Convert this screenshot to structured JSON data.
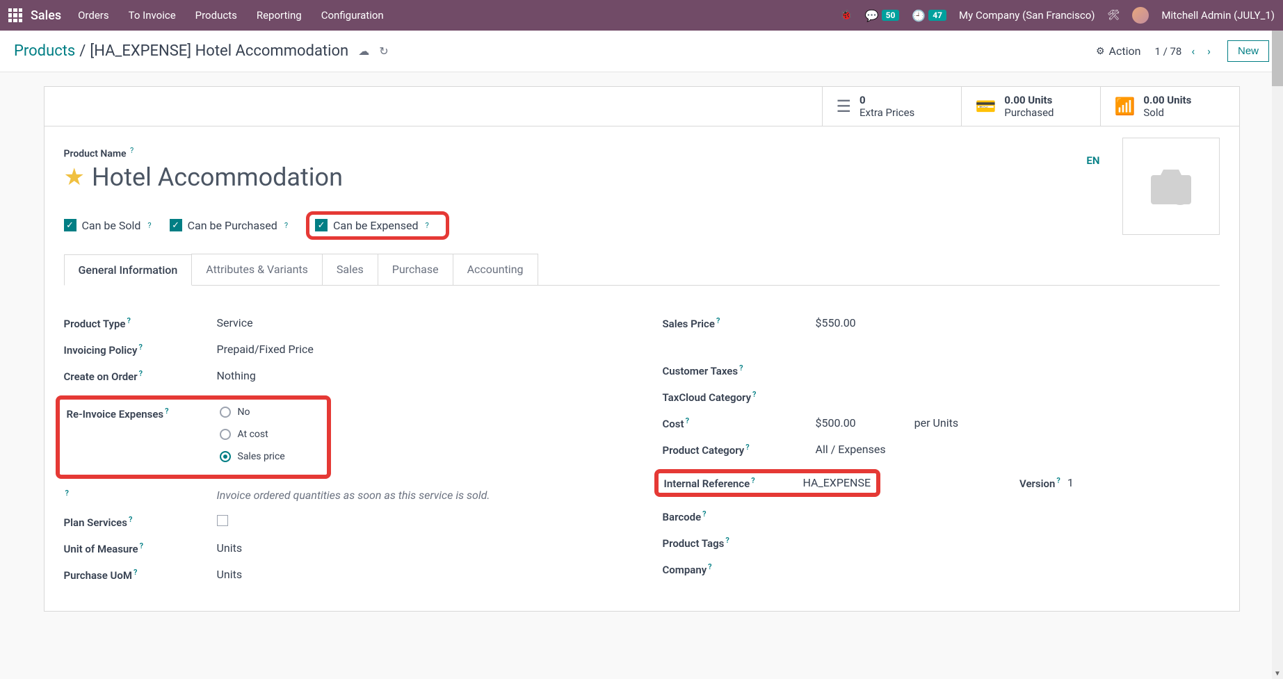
{
  "nav": {
    "app": "Sales",
    "links": [
      "Orders",
      "To Invoice",
      "Products",
      "Reporting",
      "Configuration"
    ],
    "messages_count": "50",
    "activities_count": "47",
    "company": "My Company (San Francisco)",
    "user": "Mitchell Admin (JULY_1)"
  },
  "breadcrumb": {
    "root": "Products",
    "current": "[HA_EXPENSE] Hotel Accommodation",
    "action_label": "Action",
    "pager": "1 / 78",
    "new_btn": "New"
  },
  "stats": {
    "extra_prices": {
      "val": "0",
      "label": "Extra Prices"
    },
    "purchased": {
      "val": "0.00 Units",
      "label": "Purchased"
    },
    "sold": {
      "val": "0.00 Units",
      "label": "Sold"
    }
  },
  "form": {
    "title_label": "Product Name",
    "title": "Hotel Accommodation",
    "lang": "EN",
    "checks": {
      "sold": "Can be Sold",
      "purchased": "Can be Purchased",
      "expensed": "Can be Expensed"
    },
    "tabs": [
      "General Information",
      "Attributes & Variants",
      "Sales",
      "Purchase",
      "Accounting"
    ]
  },
  "left_fields": {
    "product_type": {
      "label": "Product Type",
      "value": "Service"
    },
    "invoicing_policy": {
      "label": "Invoicing Policy",
      "value": "Prepaid/Fixed Price"
    },
    "create_on_order": {
      "label": "Create on Order",
      "value": "Nothing"
    },
    "reinvoice": {
      "label": "Re-Invoice Expenses",
      "opts": [
        "No",
        "At cost",
        "Sales price"
      ]
    },
    "reinvoice_hint": "Invoice ordered quantities as soon as this service is sold.",
    "plan_services": {
      "label": "Plan Services"
    },
    "uom": {
      "label": "Unit of Measure",
      "value": "Units"
    },
    "purchase_uom": {
      "label": "Purchase UoM",
      "value": "Units"
    }
  },
  "right_fields": {
    "sales_price": {
      "label": "Sales Price",
      "value": "$550.00"
    },
    "customer_taxes": {
      "label": "Customer Taxes"
    },
    "taxcloud": {
      "label": "TaxCloud Category"
    },
    "cost": {
      "label": "Cost",
      "value": "$500.00",
      "unit": "per Units"
    },
    "product_category": {
      "label": "Product Category",
      "value": "All / Expenses"
    },
    "internal_ref": {
      "label": "Internal Reference",
      "value": "HA_EXPENSE"
    },
    "version": {
      "label": "Version",
      "value": "1"
    },
    "barcode": {
      "label": "Barcode"
    },
    "product_tags": {
      "label": "Product Tags"
    },
    "company": {
      "label": "Company"
    }
  }
}
